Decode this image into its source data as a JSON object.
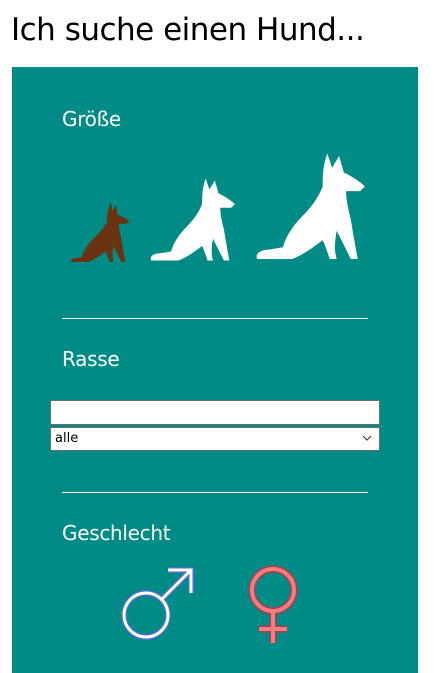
{
  "page": {
    "title": "Ich suche einen Hund..."
  },
  "filters": {
    "size": {
      "label": "Größe",
      "options": [
        {
          "name": "klein",
          "selected": true,
          "color": "#6b3311"
        },
        {
          "name": "mittel",
          "selected": false,
          "color": "#ffffff"
        },
        {
          "name": "groß",
          "selected": false,
          "color": "#ffffff"
        }
      ]
    },
    "breed": {
      "label": "Rasse",
      "input_value": "",
      "select_value": "alle"
    },
    "gender": {
      "label": "Geschlecht",
      "options": [
        {
          "name": "male",
          "icon": "male-symbol-icon",
          "color": "#4a6fc9"
        },
        {
          "name": "female",
          "icon": "female-symbol-icon",
          "color": "#f07f84"
        }
      ]
    }
  },
  "colors": {
    "panel": "#008b87",
    "text": "#ffffff"
  }
}
